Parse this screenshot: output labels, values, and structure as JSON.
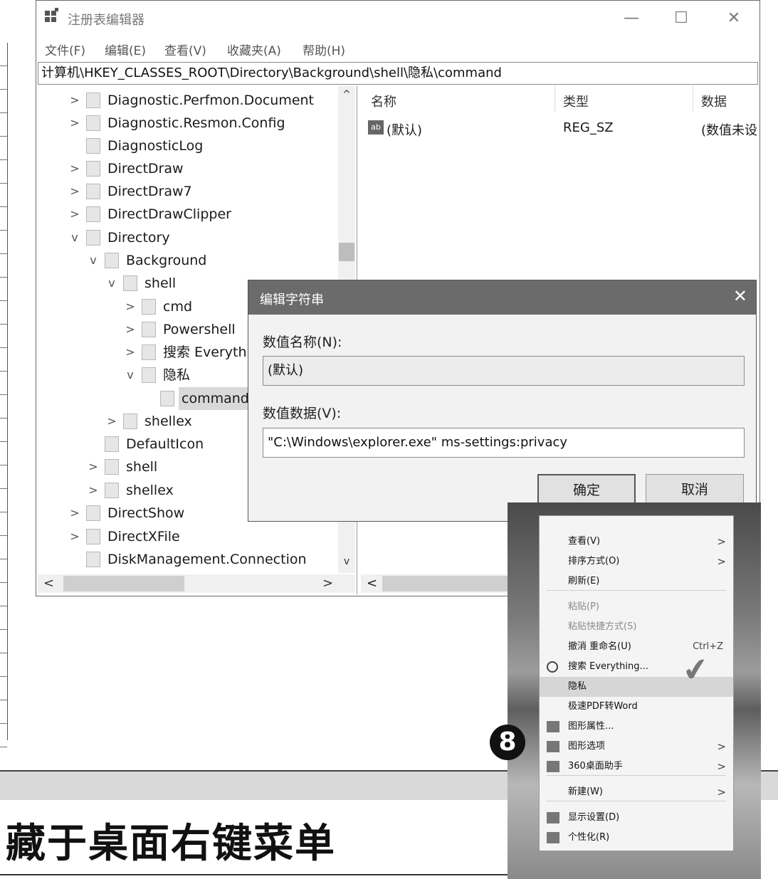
{
  "window": {
    "title": "注册表编辑器",
    "minimize_label": "—",
    "maximize_label": "☐",
    "close_label": "✕"
  },
  "menu": [
    "文件(F)",
    "编辑(E)",
    "查看(V)",
    "收藏夹(A)",
    "帮助(H)"
  ],
  "address": "计算机\\HKEY_CLASSES_ROOT\\Directory\\Background\\shell\\隐私\\command",
  "tree": [
    {
      "label": "Diagnostic.Perfmon.Document",
      "chev": ">"
    },
    {
      "label": "Diagnostic.Resmon.Config",
      "chev": ">"
    },
    {
      "label": "DiagnosticLog",
      "chev": ""
    },
    {
      "label": "DirectDraw",
      "chev": ">"
    },
    {
      "label": "DirectDraw7",
      "chev": ">"
    },
    {
      "label": "DirectDrawClipper",
      "chev": ">"
    },
    {
      "label": "Directory",
      "chev": "v"
    },
    {
      "label": "Background",
      "chev": "v"
    },
    {
      "label": "shell",
      "chev": "v"
    },
    {
      "label": "cmd",
      "chev": ">"
    },
    {
      "label": "Powershell",
      "chev": ">"
    },
    {
      "label": "搜索 Everythin",
      "chev": ">"
    },
    {
      "label": "隐私",
      "chev": "v"
    },
    {
      "label": "command",
      "chev": ""
    },
    {
      "label": "shellex",
      "chev": ">"
    },
    {
      "label": "DefaultIcon",
      "chev": ""
    },
    {
      "label": "shell",
      "chev": ">"
    },
    {
      "label": "shellex",
      "chev": ">"
    },
    {
      "label": "DirectShow",
      "chev": ">"
    },
    {
      "label": "DirectXFile",
      "chev": ">"
    },
    {
      "label": "DiskManagement.Connection",
      "chev": ""
    }
  ],
  "values": {
    "columns": [
      "名称",
      "类型",
      "数据"
    ],
    "rows": [
      {
        "icon": "ab",
        "name": "(默认)",
        "type": "REG_SZ",
        "data": "(数值未设"
      }
    ]
  },
  "dialog": {
    "title": "编辑字符串",
    "close_label": "✕",
    "name_label": "数值名称(N):",
    "name_value": "(默认)",
    "data_label": "数值数据(V):",
    "data_value": "\"C:\\Windows\\explorer.exe\" ms-settings:privacy",
    "ok_label": "确定",
    "cancel_label": "取消"
  },
  "heading": "藏于桌面右键菜单",
  "badge": "8",
  "context_menu": {
    "items": [
      {
        "label": "查看(V)",
        "arrow": ">"
      },
      {
        "label": "排序方式(O)",
        "arrow": ">"
      },
      {
        "label": "刷新(E)"
      },
      {
        "label": "粘贴(P)"
      },
      {
        "label": "粘贴快捷方式(S)"
      },
      {
        "label": "撤消 重命名(U)",
        "shortcut": "Ctrl+Z"
      },
      {
        "label": "搜索 Everything..."
      },
      {
        "label": "隐私"
      },
      {
        "label": "极速PDF转Word"
      },
      {
        "label": "图形属性..."
      },
      {
        "label": "图形选项",
        "arrow": ">"
      },
      {
        "label": "360桌面助手",
        "arrow": ">"
      },
      {
        "label": "新建(W)",
        "arrow": ">"
      },
      {
        "label": "显示设置(D)"
      },
      {
        "label": "个性化(R)"
      }
    ],
    "checkmark": "✔"
  },
  "colors": {
    "dialog_title_bg": "#6b6b6b",
    "highlight": "#d6d6d6",
    "band": "#d9d9d9"
  }
}
